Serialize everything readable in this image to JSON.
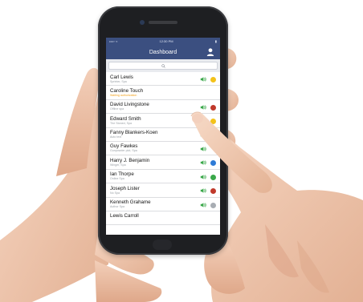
{
  "status_bar": {
    "carrier": "••••◦ ≈",
    "time": "12:30 PM",
    "battery": "▮"
  },
  "nav": {
    "title": "Dashboard",
    "user_icon": "user-icon"
  },
  "search": {
    "icon": "search-icon"
  },
  "contacts": [
    {
      "name": "Carl Lewis",
      "subtitle": "Sprinter, Spa",
      "subtitle_alert": false,
      "speaker": true,
      "status": "#f3c21a"
    },
    {
      "name": "Caroline Touch",
      "subtitle": "Waiting authorization",
      "subtitle_alert": true,
      "speaker": false,
      "status": ""
    },
    {
      "name": "David Livingstone",
      "subtitle": "Offline spa",
      "subtitle_alert": false,
      "speaker": true,
      "status": "#c0392b"
    },
    {
      "name": "Edward Smith",
      "subtitle": "The Stoned, Spa",
      "subtitle_alert": false,
      "speaker": true,
      "status": "#f3c21a"
    },
    {
      "name": "Fanny Blankers-Koen",
      "subtitle": "Auto text",
      "subtitle_alert": false,
      "speaker": true,
      "status": ""
    },
    {
      "name": "Guy Fawkes",
      "subtitle": "Gunpowder plot, Spa",
      "subtitle_alert": false,
      "speaker": true,
      "status": ""
    },
    {
      "name": "Harry J. Benjamin",
      "subtitle": "Winger, Spa",
      "subtitle_alert": false,
      "speaker": true,
      "status": "#2e7bd6"
    },
    {
      "name": "Ian Thorpe",
      "subtitle": "Online Spa",
      "subtitle_alert": false,
      "speaker": true,
      "status": "#3aa84a"
    },
    {
      "name": "Joseph Lister",
      "subtitle": "No Spa",
      "subtitle_alert": false,
      "speaker": true,
      "status": "#c0392b"
    },
    {
      "name": "Kenneth Grahame",
      "subtitle": "Author Spa",
      "subtitle_alert": false,
      "speaker": true,
      "status": "#a8adb3"
    },
    {
      "name": "Lewis Carroll",
      "subtitle": "",
      "subtitle_alert": false,
      "speaker": false,
      "status": ""
    }
  ],
  "colors": {
    "accent": "#3b4f80",
    "speaker_green": "#3aa84a",
    "background": "#ffffff",
    "skin": "#f0c9b0"
  }
}
